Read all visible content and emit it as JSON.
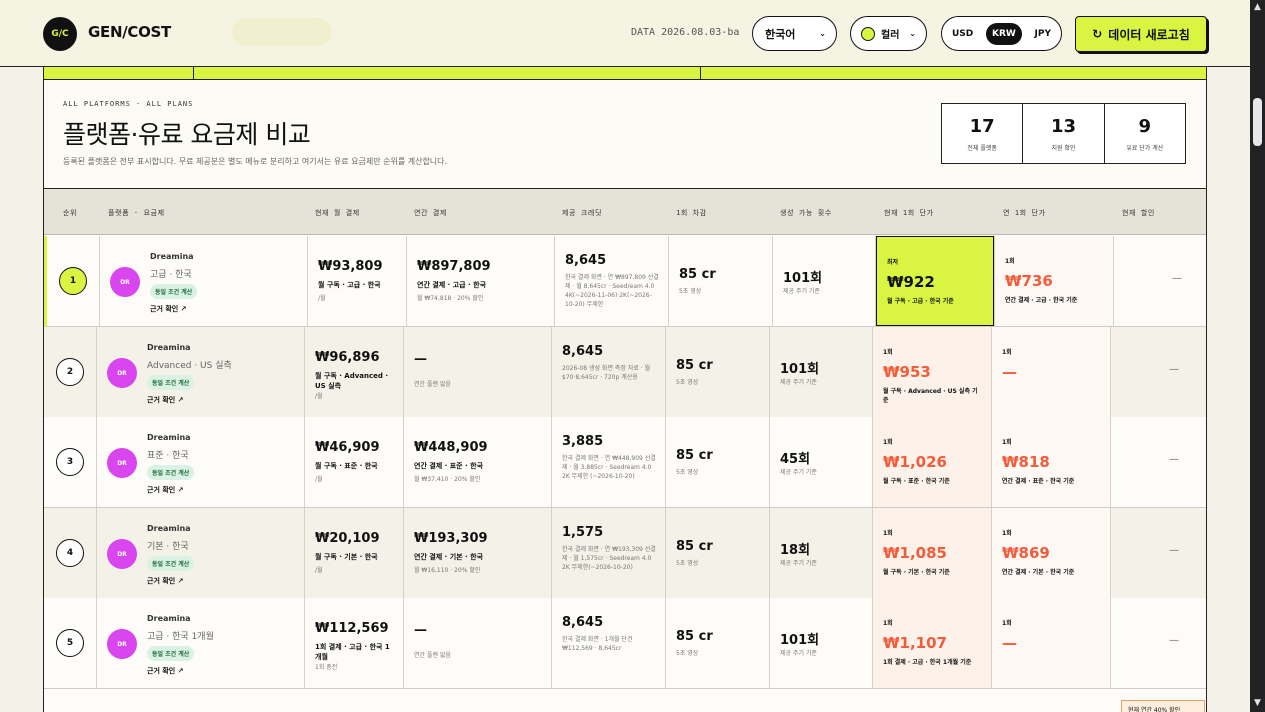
{
  "header": {
    "logo_mark": "G/C",
    "brand": "GEN/COST",
    "data_stamp": "DATA 2026.08.03-ba",
    "language": "한국어",
    "color_label": "컬러",
    "currencies": [
      "USD",
      "KRW",
      "JPY"
    ],
    "active_currency": "KRW",
    "refresh_label": "데이터 새로고침",
    "accent_color": "#d9f542"
  },
  "section": {
    "eyebrow": "ALL PLATFORMS · ALL PLANS",
    "title": "플랫폼·유료 요금제 비교",
    "subtitle": "등록된 플랫폼은 전부 표시합니다. 무료 제공분은 별도 메뉴로 분리하고 여기서는 유료 요금제만 순위를 계산합니다."
  },
  "stats": [
    {
      "value": "17",
      "label": "전체 플랫폼"
    },
    {
      "value": "13",
      "label": "지원 확인"
    },
    {
      "value": "9",
      "label": "유료 단가 계산"
    }
  ],
  "table": {
    "columns": [
      "순위",
      "플랫폼 · 요금제",
      "현재 월 결제",
      "연간 결제",
      "제공 크레딧",
      "1회 차감",
      "생성 가능 횟수",
      "현재 1회 단가",
      "연 1회 단가",
      "현재 할인"
    ],
    "rows": [
      {
        "rank": "1",
        "avatar": "DR",
        "platform": "Dreamina",
        "plan": "고급 · 한국",
        "badge": "동일 조건 계산",
        "evidence": "근거 확인 ↗",
        "monthly": "₩93,809",
        "monthly_sub": "월 구독 · 고급 · 한국",
        "monthly_note": "/월",
        "annual": "₩897,809",
        "annual_sub": "연간 결제 · 고급 · 한국",
        "annual_note": "월 ₩74,818 · 20% 할인",
        "credits": "8,645",
        "credits_note": "한국 결제 화면 · 연 ₩897,809 선결제 · 월 8,645cr · Seedream 4.0 4K(~2026-11-06)·2K(~2026-10-20) 무제한",
        "cost": "85 cr",
        "cost_note": "5초 영상",
        "count": "101회",
        "count_note": "제공 주기 기준",
        "unit_label": "최저",
        "unit": "₩922",
        "unit_sub": "월 구독 · 고급 · 한국 기준",
        "annual_label": "1회",
        "annual_unit": "₩736",
        "annual_unit_sub": "연간 결제 · 고급 · 한국 기준",
        "discount": "—"
      },
      {
        "rank": "2",
        "avatar": "DR",
        "platform": "Dreamina",
        "plan": "Advanced · US 실측",
        "badge": "동일 조건 계산",
        "evidence": "근거 확인 ↗",
        "monthly": "₩96,896",
        "monthly_sub": "월 구독 · Advanced · US 실측",
        "monthly_note": "/월",
        "annual": "—",
        "annual_sub": "",
        "annual_note": "연간 플랜 없음",
        "credits": "8,645",
        "credits_note": "2026-08 생성 화면 측정 자료 · 월 $70·8,645cr · 720p 계산용",
        "cost": "85 cr",
        "cost_note": "5초 영상",
        "count": "101회",
        "count_note": "제공 주기 기준",
        "unit_label": "1회",
        "unit": "₩953",
        "unit_sub": "월 구독 · Advanced · US 실측 기준",
        "annual_label": "1회",
        "annual_unit": "—",
        "annual_unit_sub": "",
        "discount": "—"
      },
      {
        "rank": "3",
        "avatar": "DR",
        "platform": "Dreamina",
        "plan": "표준 · 한국",
        "badge": "동일 조건 계산",
        "evidence": "근거 확인 ↗",
        "monthly": "₩46,909",
        "monthly_sub": "월 구독 · 표준 · 한국",
        "monthly_note": "/월",
        "annual": "₩448,909",
        "annual_sub": "연간 결제 · 표준 · 한국",
        "annual_note": "월 ₩37,410 · 20% 할인",
        "credits": "3,885",
        "credits_note": "한국 결제 화면 · 연 ₩448,909 선결제 · 월 3,885cr · Seedream 4.0 2K 무제한 (~2026-10-20)",
        "cost": "85 cr",
        "cost_note": "5초 영상",
        "count": "45회",
        "count_note": "제공 주기 기준",
        "unit_label": "1회",
        "unit": "₩1,026",
        "unit_sub": "월 구독 · 표준 · 한국 기준",
        "annual_label": "1회",
        "annual_unit": "₩818",
        "annual_unit_sub": "연간 결제 · 표준 · 한국 기준",
        "discount": "—"
      },
      {
        "rank": "4",
        "avatar": "DR",
        "platform": "Dreamina",
        "plan": "기본 · 한국",
        "badge": "동일 조건 계산",
        "evidence": "근거 확인 ↗",
        "monthly": "₩20,109",
        "monthly_sub": "월 구독 · 기본 · 한국",
        "monthly_note": "/월",
        "annual": "₩193,309",
        "annual_sub": "연간 결제 · 기본 · 한국",
        "annual_note": "월 ₩16,110 · 20% 할인",
        "credits": "1,575",
        "credits_note": "한국 결제 화면 · 연 ₩193,309 선결제 · 월 1,575cr · Seedream 4.0 2K 무제한(~2026-10-20)",
        "cost": "85 cr",
        "cost_note": "5초 영상",
        "count": "18회",
        "count_note": "제공 주기 기준",
        "unit_label": "1회",
        "unit": "₩1,085",
        "unit_sub": "월 구독 · 기본 · 한국 기준",
        "annual_label": "1회",
        "annual_unit": "₩869",
        "annual_unit_sub": "연간 결제 · 기본 · 한국 기준",
        "discount": "—"
      },
      {
        "rank": "5",
        "avatar": "DR",
        "platform": "Dreamina",
        "plan": "고급 · 한국 1개월",
        "badge": "동일 조건 계산",
        "evidence": "근거 확인 ↗",
        "monthly": "₩112,569",
        "monthly_sub": "1회 결제 · 고급 · 한국 1개월",
        "monthly_note": "1회 충전",
        "annual": "—",
        "annual_sub": "",
        "annual_note": "연간 플랜 없음",
        "credits": "8,645",
        "credits_note": "한국 결제 화면 · 1개월 단건 ₩112,569 · 8,645cr",
        "cost": "85 cr",
        "cost_note": "5초 영상",
        "count": "101회",
        "count_note": "제공 주기 기준",
        "unit_label": "1회",
        "unit": "₩1,107",
        "unit_sub": "1회 결제 · 고급 · 한국 1개월 기준",
        "annual_label": "1회",
        "annual_unit": "—",
        "annual_unit_sub": "",
        "discount": "—"
      }
    ],
    "next_row_discount": "현재 연간 40% 할인"
  }
}
